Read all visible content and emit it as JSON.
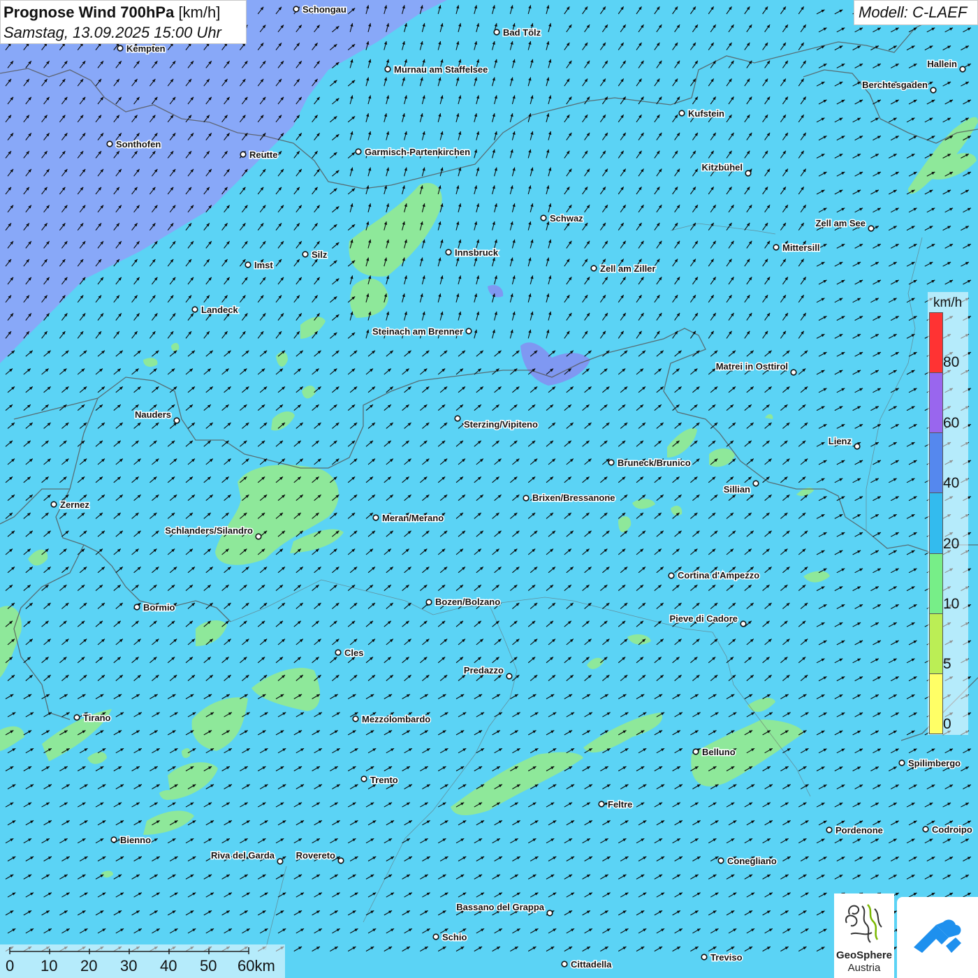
{
  "title": {
    "main_bold": "Prognose Wind 700hPa",
    "main_unit": "[km/h]",
    "date": "Samstag, 13.09.2025 15:00 Uhr"
  },
  "model": "Modell: C-LAEF",
  "legend": {
    "unit": "km/h",
    "labels": [
      "80",
      "60",
      "40",
      "20",
      "10",
      "5",
      "0"
    ],
    "colors_top_to_bottom": [
      "#ff3333",
      "#9966ee",
      "#5588ee",
      "#33bbee",
      "#77ee88",
      "#bbee55",
      "#ffff66"
    ]
  },
  "scale_bar": {
    "labels": [
      "0",
      "10",
      "20",
      "30",
      "40",
      "50",
      "60km"
    ]
  },
  "logos": {
    "geosphere_name": "GeoSphere",
    "geosphere_sub": "Austria",
    "app_icon": "weather-app-icon"
  },
  "colors": {
    "wind_base": "#5bd3f5",
    "wind_high": "#88a8f8",
    "wind_low": "#8ee89a",
    "arrow": "#0a0a0a",
    "border": "#555555"
  },
  "cities": [
    {
      "name": "Schongau"
    },
    {
      "name": "Bad Tölz"
    },
    {
      "name": "Kempten"
    },
    {
      "name": "Murnau am Staffelsee"
    },
    {
      "name": "Hallein"
    },
    {
      "name": "Berchtesgaden"
    },
    {
      "name": "Kufstein"
    },
    {
      "name": "Sonthofen"
    },
    {
      "name": "Reutte"
    },
    {
      "name": "Garmisch-Partenkirchen"
    },
    {
      "name": "Kitzbühel"
    },
    {
      "name": "Schwaz"
    },
    {
      "name": "Zell am See"
    },
    {
      "name": "Mittersill"
    },
    {
      "name": "Innsbruck"
    },
    {
      "name": "Imst"
    },
    {
      "name": "Silz"
    },
    {
      "name": "Zell am Ziller"
    },
    {
      "name": "Landeck"
    },
    {
      "name": "Steinach am Brenner"
    },
    {
      "name": "Matrei in Osttirol"
    },
    {
      "name": "Nauders"
    },
    {
      "name": "Sterzing/Vipiteno"
    },
    {
      "name": "Lienz"
    },
    {
      "name": "Bruneck/Brunico"
    },
    {
      "name": "Sillian"
    },
    {
      "name": "Zernez"
    },
    {
      "name": "Brixen/Bressanone"
    },
    {
      "name": "Meran/Merano"
    },
    {
      "name": "Schlanders/Silandro"
    },
    {
      "name": "Cortina d'Ampezzo"
    },
    {
      "name": "Bormio"
    },
    {
      "name": "Bozen/Bolzano"
    },
    {
      "name": "Pieve di Cadore"
    },
    {
      "name": "Cles"
    },
    {
      "name": "Predazzo"
    },
    {
      "name": "Tirano"
    },
    {
      "name": "Mezzolombardo"
    },
    {
      "name": "Belluno"
    },
    {
      "name": "Spilimbergo"
    },
    {
      "name": "Trento"
    },
    {
      "name": "Feltre"
    },
    {
      "name": "Pordenone"
    },
    {
      "name": "Codroipo"
    },
    {
      "name": "Bienno"
    },
    {
      "name": "Riva del Garda"
    },
    {
      "name": "Rovereto"
    },
    {
      "name": "Conegliano"
    },
    {
      "name": "Bassano del Grappa"
    },
    {
      "name": "Schio"
    },
    {
      "name": "Treviso"
    },
    {
      "name": "Cittadella"
    }
  ]
}
